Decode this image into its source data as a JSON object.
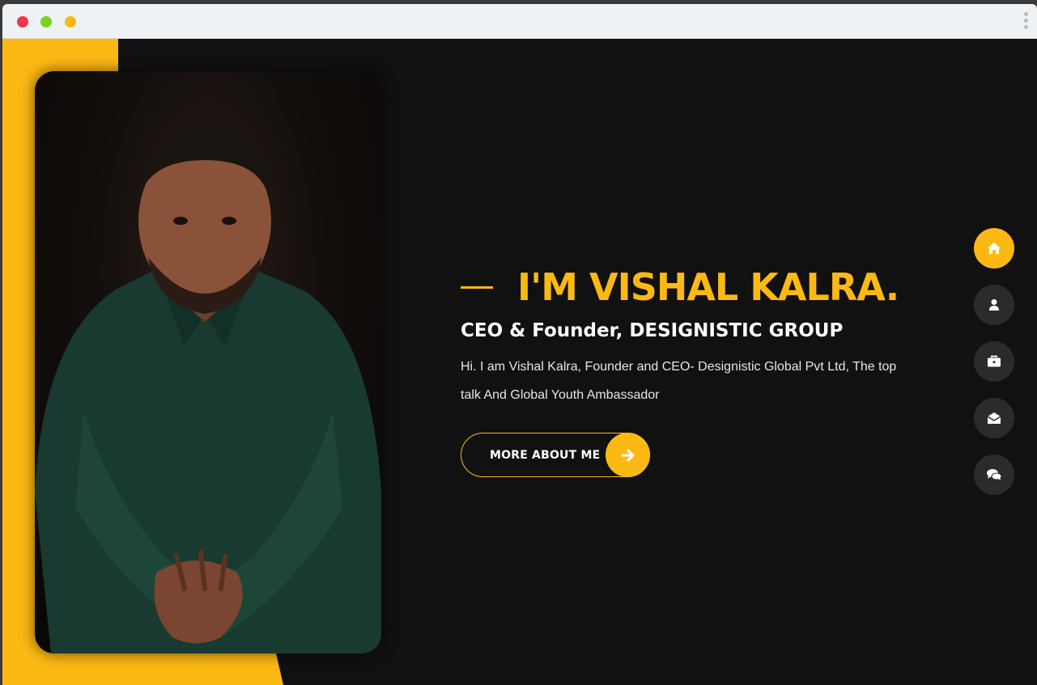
{
  "hero": {
    "heading": "I'M VISHAL KALRA.",
    "subheading": "CEO & Founder, DESIGNISTIC GROUP",
    "bio": "Hi. I am Vishal Kalra, Founder and CEO- Designistic Global Pvt Ltd, The top talk And Global Youth Ambassador",
    "cta_label": "MORE ABOUT ME",
    "cta_icon": "arrow-right-icon"
  },
  "side_nav": [
    {
      "icon": "home-icon",
      "active": true
    },
    {
      "icon": "user-icon",
      "active": false
    },
    {
      "icon": "briefcase-icon",
      "active": false
    },
    {
      "icon": "envelope-open-icon",
      "active": false
    },
    {
      "icon": "comments-icon",
      "active": false
    }
  ],
  "colors": {
    "accent": "#fdb913",
    "background": "#111111",
    "nav_inactive": "#2b2b2b",
    "text_primary": "#ffffff"
  }
}
